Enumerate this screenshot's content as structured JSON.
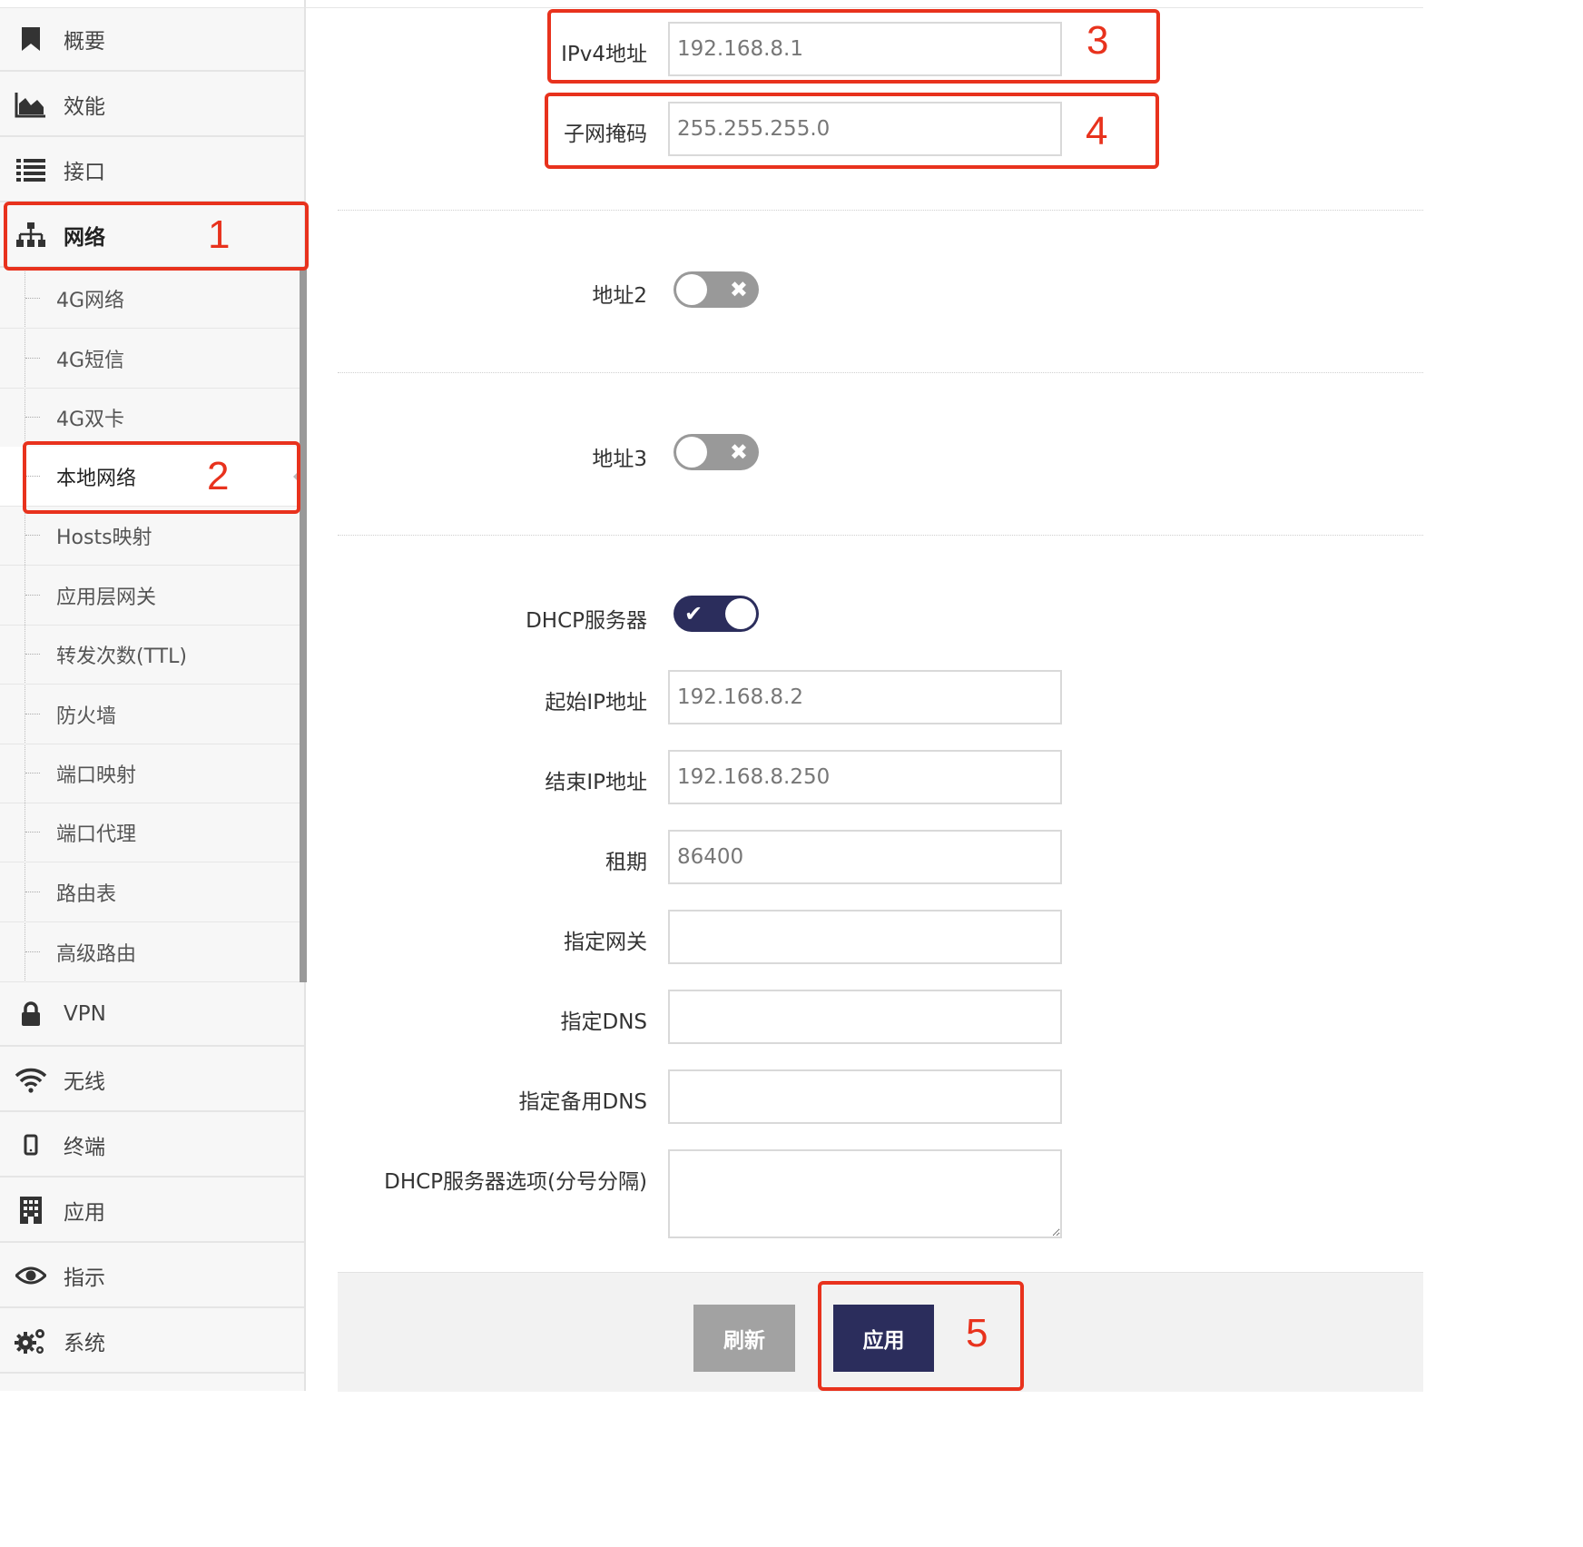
{
  "sidebar": {
    "top_items": [
      {
        "label": "概要",
        "icon": "bookmark-icon"
      },
      {
        "label": "效能",
        "icon": "area-chart-icon"
      },
      {
        "label": "接口",
        "icon": "list-icon"
      },
      {
        "label": "网络",
        "icon": "sitemap-icon"
      }
    ],
    "submenu": [
      {
        "label": "4G网络"
      },
      {
        "label": "4G短信"
      },
      {
        "label": "4G双卡"
      },
      {
        "label": "本地网络",
        "active": true
      },
      {
        "label": "Hosts映射"
      },
      {
        "label": "应用层网关"
      },
      {
        "label": "转发次数(TTL)"
      },
      {
        "label": "防火墙"
      },
      {
        "label": "端口映射"
      },
      {
        "label": "端口代理"
      },
      {
        "label": "路由表"
      },
      {
        "label": "高级路由"
      }
    ],
    "bottom_items": [
      {
        "label": "VPN",
        "icon": "lock-icon"
      },
      {
        "label": "无线",
        "icon": "wifi-icon"
      },
      {
        "label": "终端",
        "icon": "mobile-icon"
      },
      {
        "label": "应用",
        "icon": "building-icon"
      },
      {
        "label": "指示",
        "icon": "eye-icon"
      },
      {
        "label": "系统",
        "icon": "gears-icon"
      }
    ]
  },
  "form": {
    "ipv4": {
      "label": "IPv4地址",
      "value": "192.168.8.1"
    },
    "netmask": {
      "label": "子网掩码",
      "value": "255.255.255.0"
    },
    "addr2": {
      "label": "地址2",
      "enabled": false
    },
    "addr3": {
      "label": "地址3",
      "enabled": false
    },
    "dhcp": {
      "label": "DHCP服务器",
      "enabled": true
    },
    "start_ip": {
      "label": "起始IP地址",
      "value": "192.168.8.2"
    },
    "end_ip": {
      "label": "结束IP地址",
      "value": "192.168.8.250"
    },
    "lease": {
      "label": "租期",
      "value": "86400"
    },
    "gateway": {
      "label": "指定网关",
      "value": ""
    },
    "dns": {
      "label": "指定DNS",
      "value": ""
    },
    "dns_backup": {
      "label": "指定备用DNS",
      "value": ""
    },
    "dhcp_options": {
      "label": "DHCP服务器选项(分号分隔)",
      "value": ""
    }
  },
  "toggle_marks": {
    "on": "✔",
    "off": "✖"
  },
  "buttons": {
    "refresh": "刷新",
    "apply": "应用"
  },
  "annotations": [
    "1",
    "2",
    "3",
    "4",
    "5"
  ],
  "colors": {
    "accent": "#2b2d5c",
    "callout": "#e8321d",
    "toggle_off": "#999999",
    "button_secondary": "#a2a2a2"
  }
}
